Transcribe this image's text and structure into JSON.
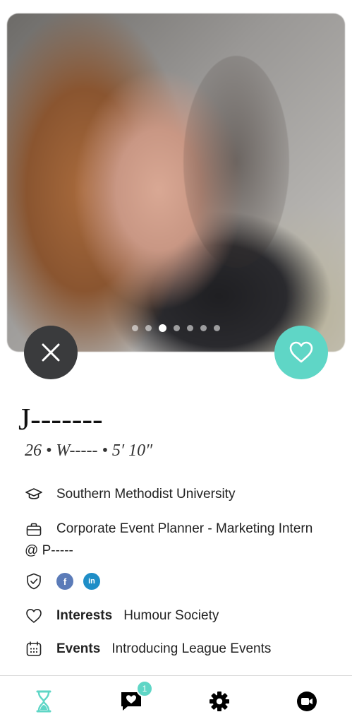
{
  "profile": {
    "name": "J-------",
    "meta": "26 • W----- • 5′ 10″",
    "school": "Southern Methodist University",
    "job": "Corporate Event Planner - Marketing Intern @ P-----",
    "interests_label": "Interests",
    "interests_value": "Humour Society",
    "events_label": "Events",
    "events_value": "Introducing League Events",
    "social": {
      "facebook": "f",
      "linkedin": "in"
    }
  },
  "photo": {
    "count": 7,
    "active_index": 2
  },
  "nav": {
    "messages_badge": "1"
  },
  "colors": {
    "accent": "#5fd6c6",
    "dark_button": "#3a3b3d",
    "facebook": "#5b7bb8",
    "linkedin": "#1f8ec7"
  }
}
